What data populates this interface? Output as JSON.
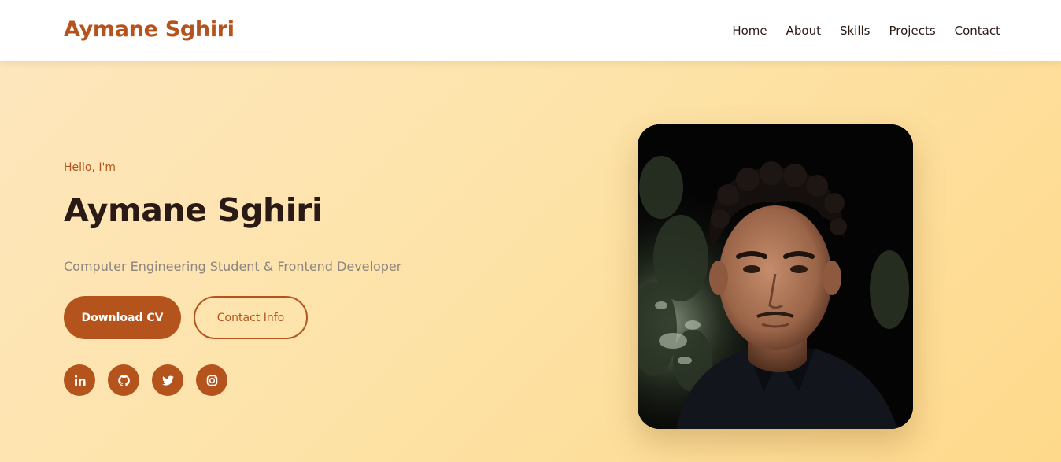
{
  "header": {
    "brand": "Aymane Sghiri",
    "nav": [
      "Home",
      "About",
      "Skills",
      "Projects",
      "Contact"
    ]
  },
  "hero": {
    "greeting": "Hello, I'm",
    "name": "Aymane Sghiri",
    "subtitle": "Computer Engineering Student & Frontend Developer",
    "download_cv_label": "Download CV",
    "contact_info_label": "Contact Info",
    "socials": [
      "linkedin-icon",
      "github-icon",
      "twitter-icon",
      "instagram-icon"
    ],
    "photo_alt": "profile photo"
  },
  "colors": {
    "accent": "#b5531d",
    "text_dark": "#2a1a16",
    "subtitle": "#8d8580",
    "hero_bg_start": "#fee6bd",
    "hero_bg_end": "#fed98b"
  }
}
